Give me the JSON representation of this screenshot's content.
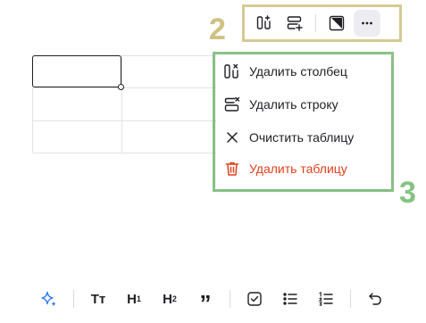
{
  "annotations": {
    "toolbar_number": "2",
    "menu_number": "3"
  },
  "toolbar": {
    "buttons": [
      "add-column-icon",
      "add-row-icon",
      "cell-color-icon",
      "more-icon"
    ]
  },
  "menu": {
    "items": [
      {
        "label": "Удалить столбец",
        "icon": "delete-column-icon"
      },
      {
        "label": "Удалить строку",
        "icon": "delete-row-icon"
      },
      {
        "label": "Очистить таблицу",
        "icon": "close-icon"
      },
      {
        "label": "Удалить таблицу",
        "icon": "trash-icon",
        "color": "#e0401c"
      }
    ]
  },
  "bottom_toolbar": {
    "text_button": "Tт",
    "h1": "H",
    "h1_sub": "1",
    "h2": "H",
    "h2_sub": "2",
    "quote": "”"
  },
  "colors": {
    "accent": "#2f7bf5",
    "danger": "#e0401c",
    "annotation_toolbar": "#cfc183",
    "annotation_menu": "#86c283"
  }
}
